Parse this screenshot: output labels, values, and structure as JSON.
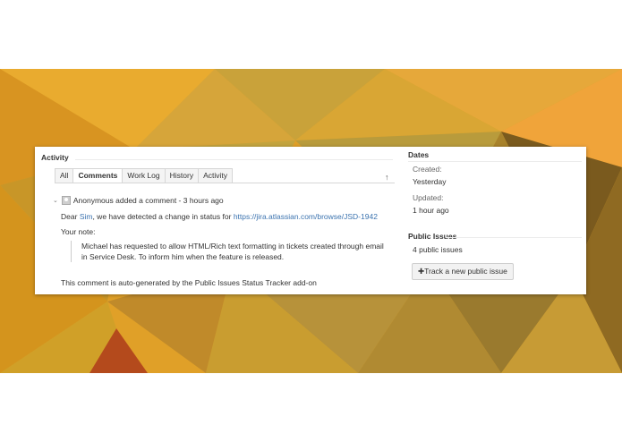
{
  "background": {
    "colors": [
      "#e9a426",
      "#d98f1c",
      "#c9a23a",
      "#b88e2b",
      "#a6782a",
      "#8a6420",
      "#6b4a1a",
      "#b44a1c"
    ]
  },
  "activity": {
    "heading": "Activity",
    "tabs": [
      {
        "label": "All",
        "active": false
      },
      {
        "label": "Comments",
        "active": true
      },
      {
        "label": "Work Log",
        "active": false
      },
      {
        "label": "History",
        "active": false
      },
      {
        "label": "Activity",
        "active": false
      }
    ],
    "sort_icon": "arrow-up-icon"
  },
  "comment": {
    "author": "Anonymous",
    "header_rest": "added a comment - 3 hours ago",
    "greeting_pre": "Dear",
    "user_name": "Sim",
    "greeting_post": ", we have detected a change in status for",
    "issue_url": "https://jira.atlassian.com/browse/JSD-1942",
    "note_label": "Your note:",
    "quote_text": "Michael has requested to allow HTML/Rich text formatting in tickets created through email in Service Desk. To inform him when the feature is released.",
    "footer": "This comment is auto-generated by the Public Issues Status Tracker add-on"
  },
  "sidebar": {
    "dates_heading": "Dates",
    "created_label": "Created:",
    "created_value": "Yesterday",
    "updated_label": "Updated:",
    "updated_value": "1 hour ago",
    "public_heading": "Public Issues",
    "public_link": "4 public issues",
    "track_button": "Track a new public issue",
    "track_icon": "plus-icon"
  }
}
